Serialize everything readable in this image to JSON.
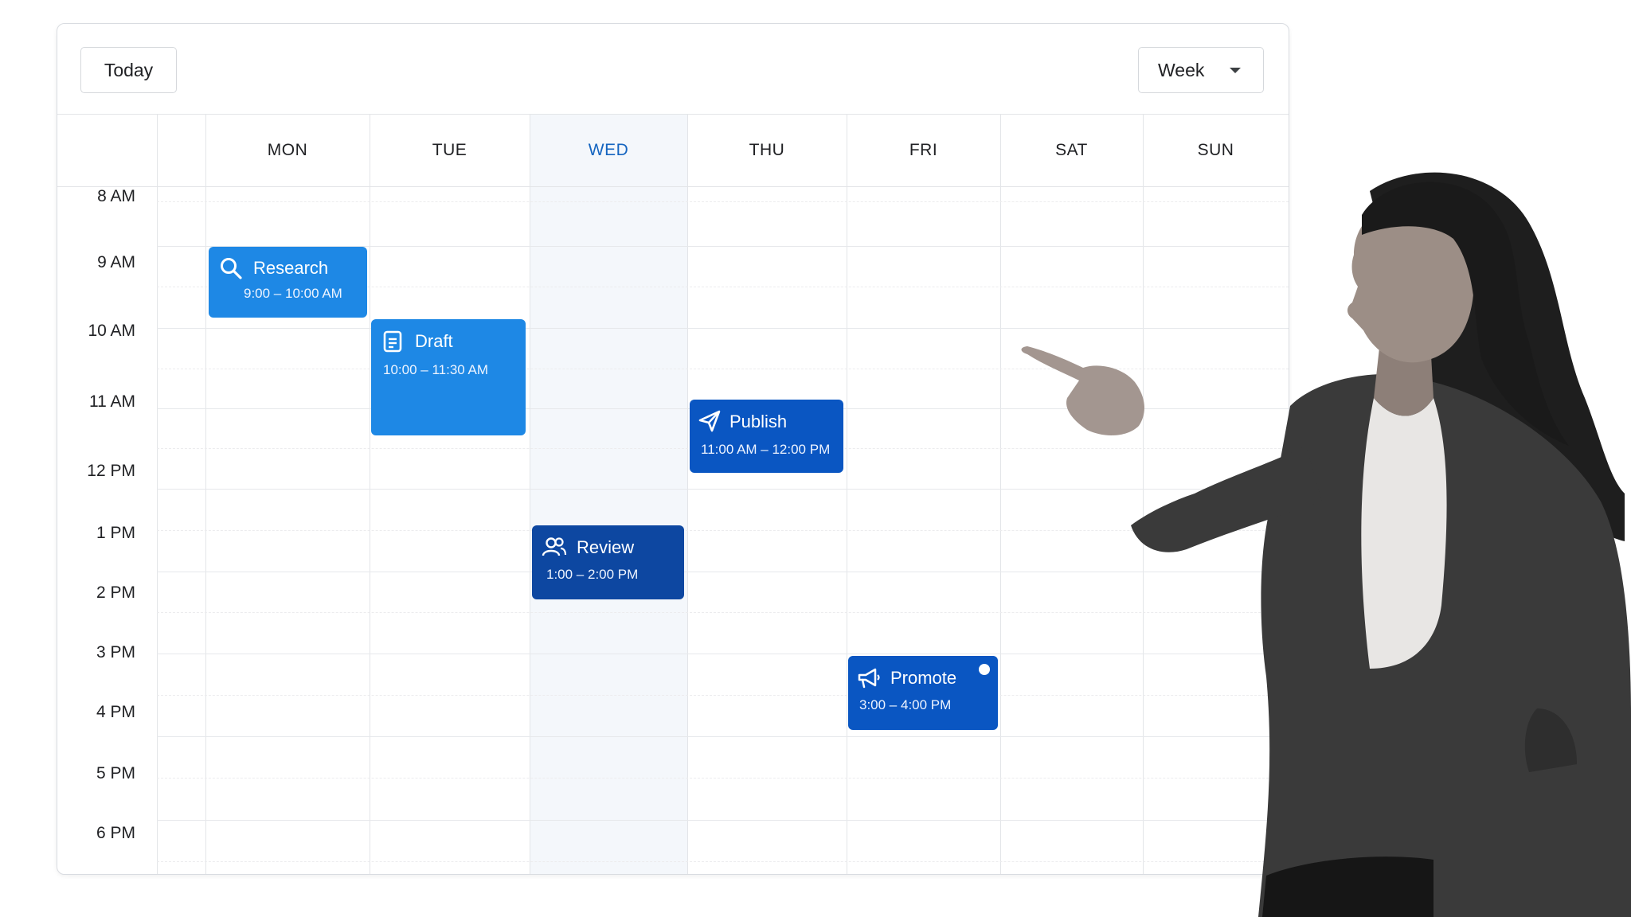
{
  "toolbar": {
    "today_label": "Today",
    "view_label": "Week"
  },
  "days": [
    "MON",
    "TUE",
    "WED",
    "THU",
    "FRI",
    "SAT",
    "SUN"
  ],
  "today_index": 2,
  "times": [
    "8 AM",
    "9 AM",
    "10 AM",
    "11 AM",
    "12 PM",
    "1 PM",
    "2 PM",
    "3 PM",
    "4 PM",
    "5 PM",
    "6 PM"
  ],
  "events": [
    {
      "title": "Research",
      "time": "9:00 – 10:00 AM",
      "icon": "search-icon",
      "day": "MON",
      "color": "#1e88e5"
    },
    {
      "title": "Draft",
      "time": "10:00 – 11:30 AM",
      "icon": "document-icon",
      "day": "TUE",
      "color": "#1e88e5"
    },
    {
      "title": "Publish",
      "time": "11:00 AM – 12:00 PM",
      "icon": "send-icon",
      "day": "THU",
      "color": "#0a56c2"
    },
    {
      "title": "Review",
      "time": "1:00 – 2:00 PM",
      "icon": "people-icon",
      "day": "WED",
      "color": "#0d47a1"
    },
    {
      "title": "Promote",
      "time": "3:00 – 4:00 PM",
      "icon": "megaphone-icon",
      "day": "FRI",
      "color": "#0a56c2"
    }
  ],
  "colors": {
    "accent": "#1565c0",
    "today_shade": "#f4f7fb"
  }
}
